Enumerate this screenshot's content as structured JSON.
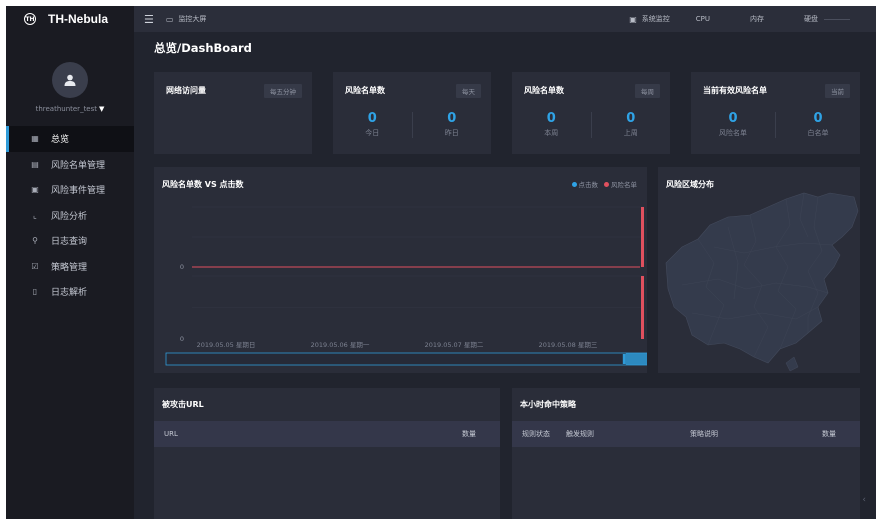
{
  "brand": {
    "logo": "TH",
    "name": "TH-Nebula"
  },
  "user": {
    "name": "threathunter_test",
    "caret": "▼"
  },
  "nav": [
    {
      "label": "总览",
      "icon": "dashboard-icon",
      "glyph": "▦",
      "active": true
    },
    {
      "label": "风险名单管理",
      "icon": "list-icon",
      "glyph": "▤",
      "active": false
    },
    {
      "label": "风险事件管理",
      "icon": "event-icon",
      "glyph": "▣",
      "active": false
    },
    {
      "label": "风险分析",
      "icon": "line-chart-icon",
      "glyph": "⌞",
      "active": false
    },
    {
      "label": "日志查询",
      "icon": "search-icon",
      "glyph": "⚲",
      "active": false
    },
    {
      "label": "策略管理",
      "icon": "strategy-icon",
      "glyph": "☑",
      "active": false
    },
    {
      "label": "日志解析",
      "icon": "document-icon",
      "glyph": "▯",
      "active": false
    }
  ],
  "topbar": {
    "screen_label": "监控大屏",
    "monitor_label": "系统监控",
    "cpu": "CPU",
    "memory": "内存",
    "disk": "硬盘"
  },
  "page_title": "总览/DashBoard",
  "stats": [
    {
      "title": "网络访问量",
      "badge": "每五分钟",
      "values": []
    },
    {
      "title": "风险名单数",
      "badge": "每天",
      "values": [
        {
          "num": "0",
          "label": "今日"
        },
        {
          "num": "0",
          "label": "昨日"
        }
      ]
    },
    {
      "title": "风险名单数",
      "badge": "每周",
      "values": [
        {
          "num": "0",
          "label": "本周"
        },
        {
          "num": "0",
          "label": "上周"
        }
      ]
    },
    {
      "title": "当前有效风险名单",
      "badge": "当前",
      "values": [
        {
          "num": "0",
          "label": "风险名单"
        },
        {
          "num": "0",
          "label": "白名单"
        }
      ]
    }
  ],
  "chart_title": "风险名单数 VS 点击数",
  "map_title": "风险区域分布",
  "chart_data": {
    "type": "line",
    "title": "风险名单数 VS 点击数",
    "categories": [
      "2019.05.05 星期日",
      "2019.05.06 星期一",
      "2019.05.07 星期二",
      "2019.05.08 星期三"
    ],
    "series": [
      {
        "name": "点击数",
        "color": "#2fa3e6",
        "values": [
          0,
          0,
          0,
          0
        ]
      },
      {
        "name": "风险名单",
        "color": "#e0505e",
        "values": [
          0,
          0,
          0,
          0
        ]
      }
    ],
    "y_ticks": [
      "0",
      "0"
    ],
    "legend_position": "top-right",
    "zoom_range": [
      0.95,
      1.0
    ]
  },
  "tables": {
    "url": {
      "title": "被攻击URL",
      "headers": [
        "URL",
        "数量"
      ]
    },
    "strategy": {
      "title": "本小时命中策略",
      "headers": [
        "规则状态",
        "触发规则",
        "策略说明",
        "数量"
      ]
    }
  },
  "colors": {
    "accent": "#2fa3e6",
    "risk": "#e0505e",
    "bg": "#21242e",
    "card": "#2a2d39"
  }
}
